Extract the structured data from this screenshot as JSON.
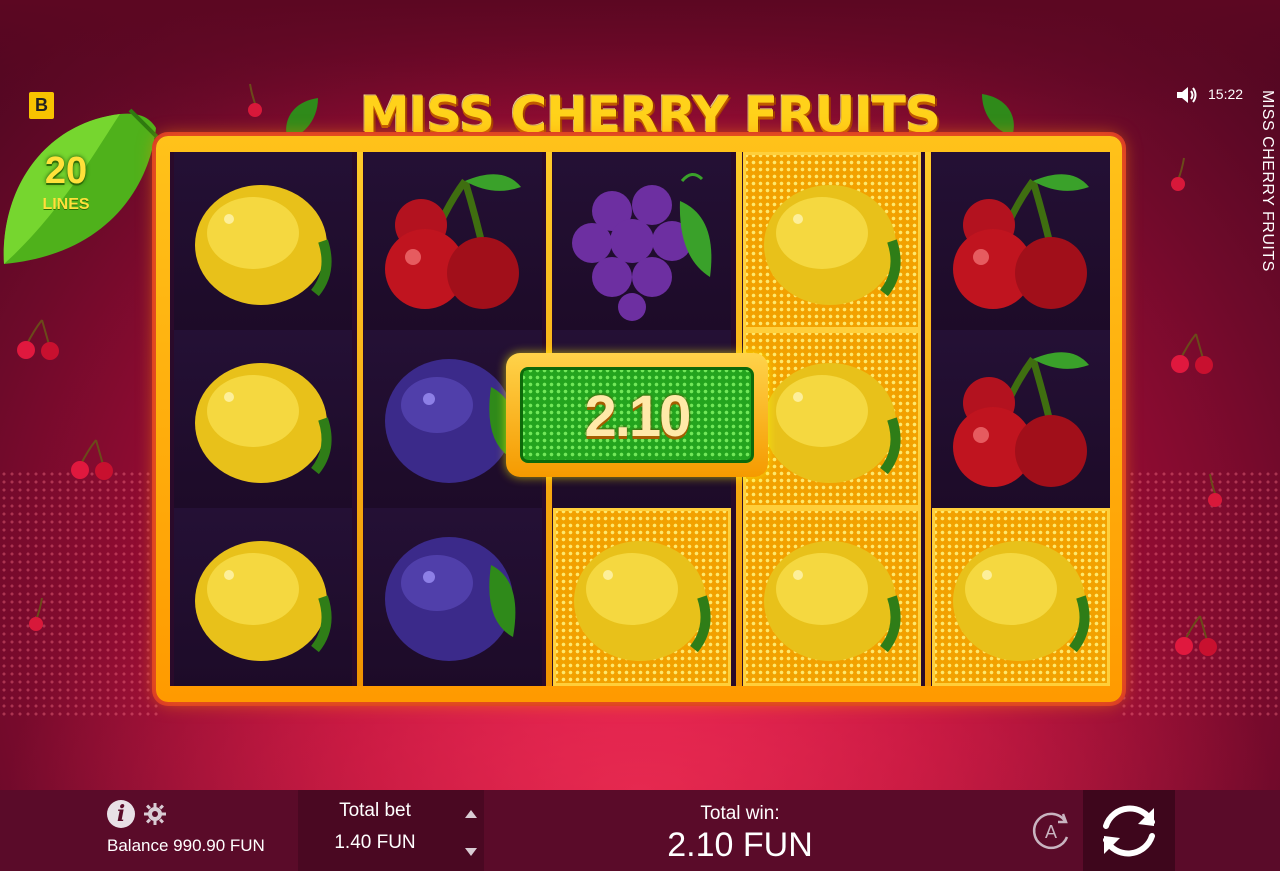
{
  "brand": {
    "letter": "B"
  },
  "lines": {
    "count": "20",
    "label": "LINES"
  },
  "title": "MISS CHERRY FRUITS",
  "side": {
    "clock": "15:22",
    "vertical_title": "MISS CHERRY FRUITS"
  },
  "reels": [
    [
      "lemon",
      "lemon",
      "lemon"
    ],
    [
      "cherry",
      "plum",
      "plum"
    ],
    [
      "grapes",
      "hidden",
      "lemon"
    ],
    [
      "lemon",
      "lemon",
      "lemon"
    ],
    [
      "cherry",
      "cherry",
      "lemon"
    ]
  ],
  "winning_cells": [
    [
      2,
      2
    ],
    [
      3,
      0
    ],
    [
      3,
      1
    ],
    [
      3,
      2
    ],
    [
      4,
      2
    ]
  ],
  "win_badge": {
    "value": "2.10"
  },
  "bottom": {
    "balance": "Balance 990.90 FUN",
    "bet_label": "Total bet",
    "bet_value": "1.40 FUN",
    "win_label": "Total win:",
    "win_value": "2.10 FUN",
    "auto_letter": "A"
  },
  "icons": [
    "sound-icon",
    "info-icon",
    "gear-icon",
    "arrow-up-icon",
    "arrow-down-icon",
    "autoplay-icon",
    "spin-icon",
    "leaf-icon",
    "cherry-icon"
  ],
  "colors": {
    "accent_gold": "#ffc21a",
    "win_green": "#23a41e",
    "bg_magenta": "#b50d3a",
    "bar": "#5a0b29"
  }
}
